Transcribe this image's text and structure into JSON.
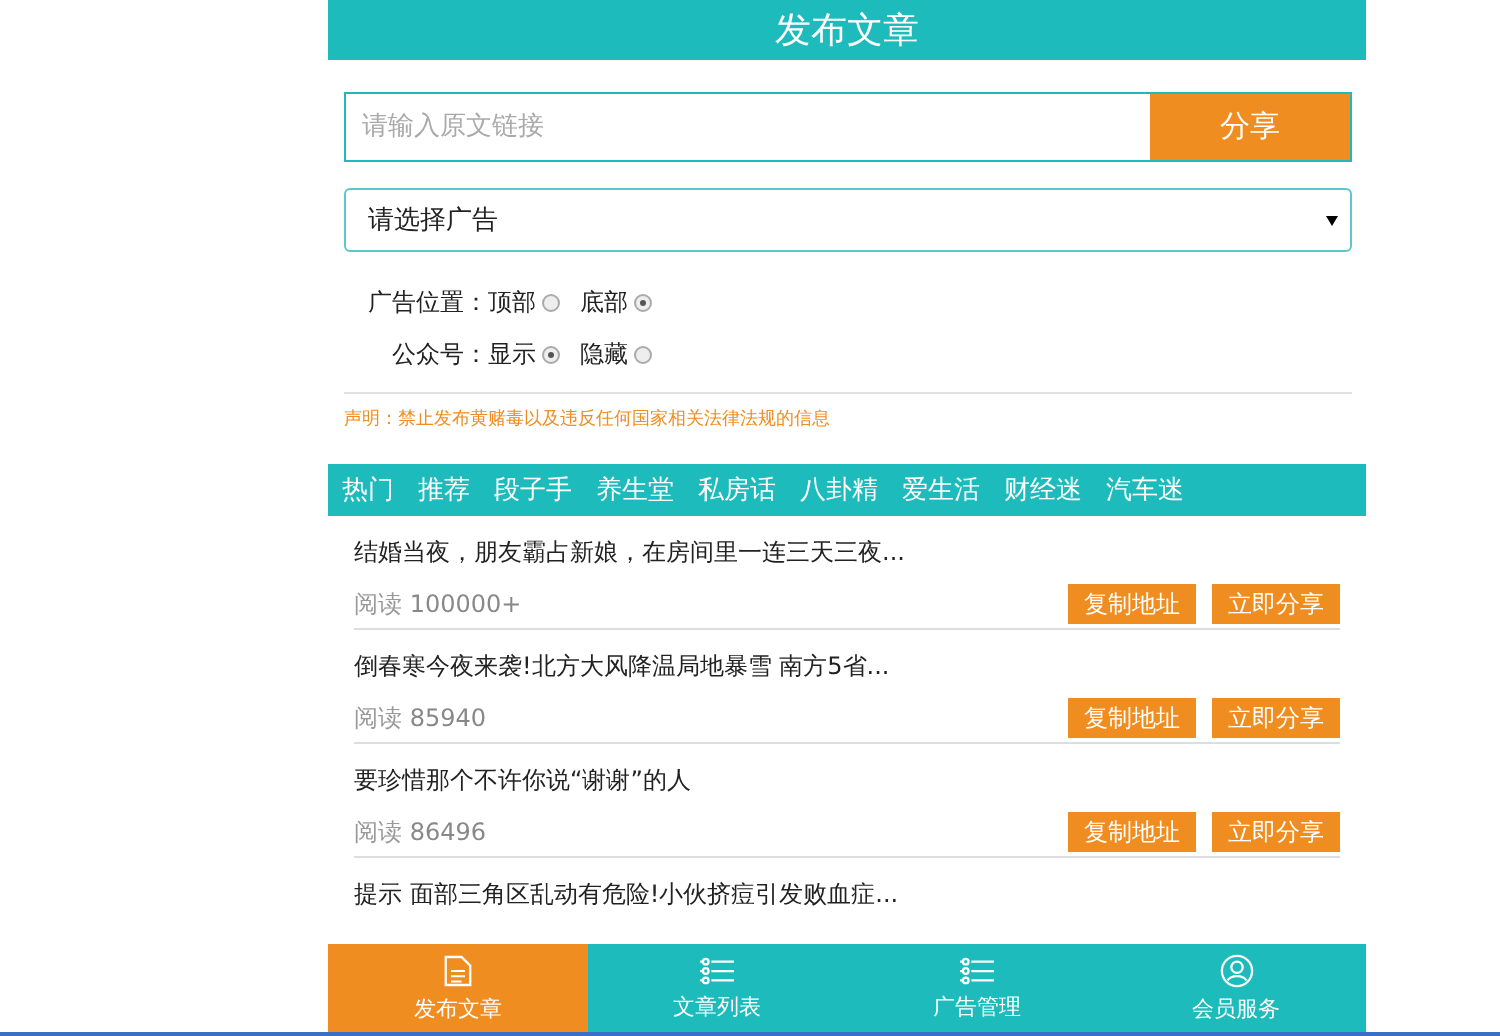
{
  "header": {
    "title": "发布文章"
  },
  "share_form": {
    "placeholder": "请输入原文链接",
    "button": "分享"
  },
  "ad_select": {
    "value": "请选择广告"
  },
  "radio_groups": [
    {
      "label": "广告位置：",
      "options": [
        {
          "label": "顶部",
          "selected": false
        },
        {
          "label": "底部",
          "selected": true
        }
      ]
    },
    {
      "label": "公众号：",
      "options": [
        {
          "label": "显示",
          "selected": true
        },
        {
          "label": "隐藏",
          "selected": false
        }
      ]
    }
  ],
  "notice": "声明：禁止发布黄赌毒以及违反任何国家相关法律法规的信息",
  "categories": [
    "热门",
    "推荐",
    "段子手",
    "养生堂",
    "私房话",
    "八卦精",
    "爱生活",
    "财经迷",
    "汽车迷"
  ],
  "articles": [
    {
      "title": "结婚当夜，朋友霸占新娘，在房间里一连三天三夜...",
      "reads_label": "阅读",
      "reads": "100000+",
      "actions": [
        "复制地址",
        "立即分享"
      ]
    },
    {
      "title": "倒春寒今夜来袭!北方大风降温局地暴雪 南方5省...",
      "reads_label": "阅读",
      "reads": "85940",
      "actions": [
        "复制地址",
        "立即分享"
      ]
    },
    {
      "title": "要珍惜那个不许你说“谢谢”的人",
      "reads_label": "阅读",
      "reads": "86496",
      "actions": [
        "复制地址",
        "立即分享"
      ]
    },
    {
      "title": "提示 面部三角区乱动有危险!小伙挤痘引发败血症..."
    }
  ],
  "bottom_nav": [
    {
      "label": "发布文章",
      "kind": "document",
      "selected": true
    },
    {
      "label": "文章列表",
      "kind": "list",
      "selected": false
    },
    {
      "label": "广告管理",
      "kind": "list",
      "selected": false
    },
    {
      "label": "会员服务",
      "kind": "user",
      "selected": false
    }
  ]
}
